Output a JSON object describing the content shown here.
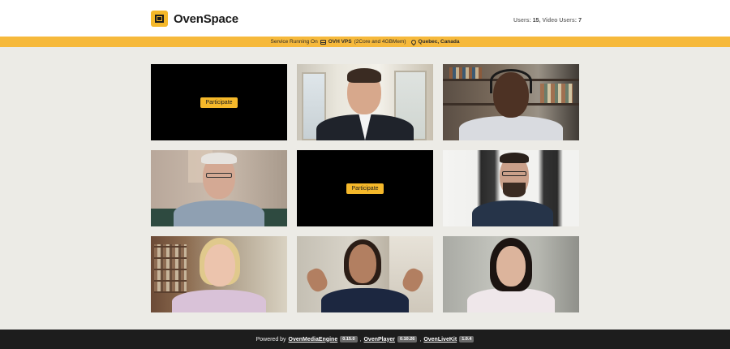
{
  "header": {
    "app_name": "OvenSpace",
    "users_label": "Users: ",
    "users_count": "15",
    "video_users_label": ", Video Users: ",
    "video_users_count": "7"
  },
  "service": {
    "prefix": "Service Running On",
    "server": "OVH VPS",
    "specs": "(2Core and 4GBMem)",
    "location": "Quebec, Canada"
  },
  "tiles": [
    {
      "kind": "empty",
      "button": "Participate"
    },
    {
      "kind": "video",
      "icon": "man-suit-video"
    },
    {
      "kind": "video",
      "icon": "man-headset-video"
    },
    {
      "kind": "video",
      "icon": "older-man-glasses-video"
    },
    {
      "kind": "empty",
      "button": "Participate"
    },
    {
      "kind": "video",
      "icon": "man-beard-glasses-video"
    },
    {
      "kind": "video",
      "icon": "blonde-woman-video"
    },
    {
      "kind": "video",
      "icon": "woman-waving-video"
    },
    {
      "kind": "video",
      "icon": "woman-dark-hair-video"
    }
  ],
  "footer": {
    "powered_by": "Powered by",
    "engine": "OvenMediaEngine",
    "engine_version": "0.15.0",
    "player": "OvenPlayer",
    "player_version": "0.10.26",
    "livekit": "OvenLiveKit",
    "livekit_version": "1.0.4",
    "sep": ","
  },
  "colors": {
    "accent": "#f6b93b",
    "background": "#ecebe6",
    "footer": "#1d1d1d"
  }
}
